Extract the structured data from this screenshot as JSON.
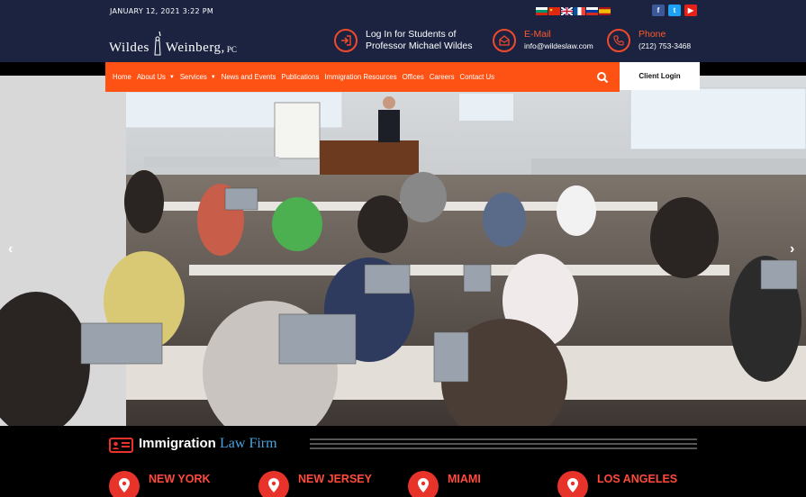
{
  "topbar": {
    "date": "JANUARY 12, 2021 3:22 PM",
    "flags": [
      "bulgarian-flag",
      "chinese-flag",
      "uk-flag",
      "french-flag",
      "russian-flag",
      "spanish-flag"
    ],
    "socials": [
      {
        "name": "facebook-icon",
        "glyph": "f",
        "color": "#3b5998"
      },
      {
        "name": "twitter-icon",
        "glyph": "t",
        "color": "#1da1f2"
      },
      {
        "name": "youtube-icon",
        "glyph": "▶",
        "color": "#e62117"
      }
    ]
  },
  "header": {
    "logo_left": "Wildes",
    "logo_right": "Weinberg,",
    "logo_pc": "PC",
    "login": {
      "line1": "Log In for Students of",
      "line2": "Professor Michael Wildes"
    },
    "email": {
      "title": "E-Mail",
      "value": "info@wildeslaw.com"
    },
    "phone": {
      "title": "Phone",
      "value": "(212) 753-3468"
    }
  },
  "nav": {
    "items": [
      {
        "label": "Home",
        "dropdown": false
      },
      {
        "label": "About Us",
        "dropdown": true
      },
      {
        "label": "Services",
        "dropdown": true
      },
      {
        "label": "News and Events",
        "dropdown": false
      },
      {
        "label": "Publications",
        "dropdown": false
      },
      {
        "label": "Immigration Resources",
        "dropdown": false
      },
      {
        "label": "Offices",
        "dropdown": false
      },
      {
        "label": "Careers",
        "dropdown": false
      },
      {
        "label": "Contact Us",
        "dropdown": false
      }
    ],
    "client_login": "Client Login",
    "caret": "▼"
  },
  "hero": {
    "prev": "‹",
    "next": "›"
  },
  "section": {
    "title_bold": "Immigration",
    "title_light": "Law Firm",
    "offices": [
      "NEW YORK",
      "NEW JERSEY",
      "MIAMI",
      "LOS ANGELES"
    ]
  },
  "colors": {
    "navy": "#1b2340",
    "accent": "#fe5114",
    "red": "#e8332a",
    "blue": "#4aa3df"
  }
}
